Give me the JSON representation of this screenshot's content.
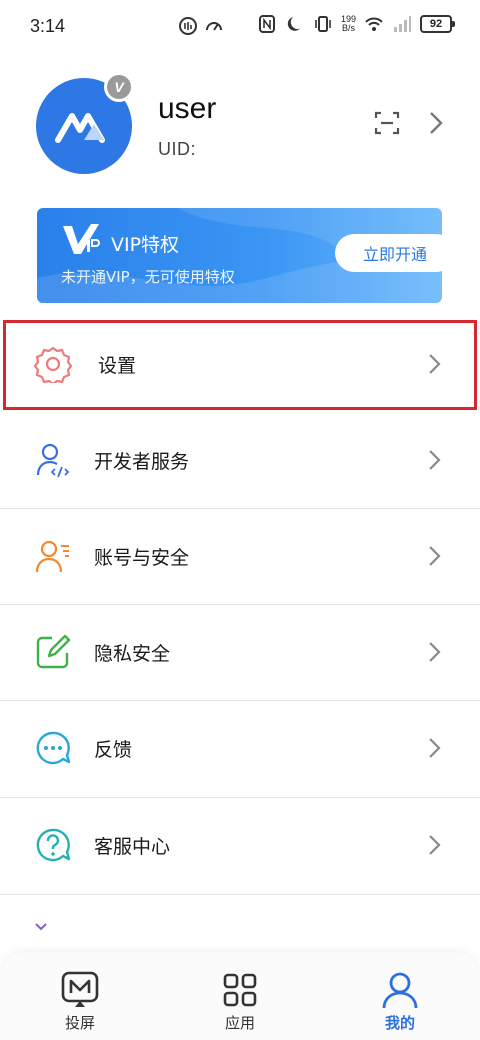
{
  "status_bar": {
    "time": "3:14",
    "net_speed_value": "199",
    "net_speed_unit": "B/s",
    "battery": "92",
    "icons": [
      "notification-icon",
      "speedometer-icon",
      "nfc-icon",
      "moon-icon",
      "vibrate-icon",
      "wifi-icon",
      "signal-icon",
      "battery-icon"
    ]
  },
  "profile": {
    "username": "user",
    "uid_label": "UID:",
    "badge": "V",
    "avatar_color": "#2e78e6"
  },
  "vip": {
    "title": "VIP特权",
    "subtitle": "未开通VIP，无可使用特权",
    "button": "立即开通",
    "accent": "#2a80ea"
  },
  "menu": {
    "items": [
      {
        "label": "设置",
        "icon": "gear-icon",
        "color": "#f07a7a"
      },
      {
        "label": "开发者服务",
        "icon": "developer-icon",
        "color": "#3b6fe0"
      },
      {
        "label": "账号与安全",
        "icon": "account-icon",
        "color": "#f08a2c"
      },
      {
        "label": "隐私安全",
        "icon": "privacy-icon",
        "color": "#3bb34a"
      },
      {
        "label": "反馈",
        "icon": "feedback-icon",
        "color": "#2aa6d8"
      },
      {
        "label": "客服中心",
        "icon": "help-icon",
        "color": "#26b0b0"
      }
    ],
    "highlight_color": "#d7282f"
  },
  "bottom_nav": {
    "tabs": [
      {
        "label": "投屏",
        "icon": "cast-icon"
      },
      {
        "label": "应用",
        "icon": "apps-grid-icon"
      },
      {
        "label": "我的",
        "icon": "person-icon",
        "active": true
      }
    ],
    "active_color": "#2c6fe0"
  }
}
